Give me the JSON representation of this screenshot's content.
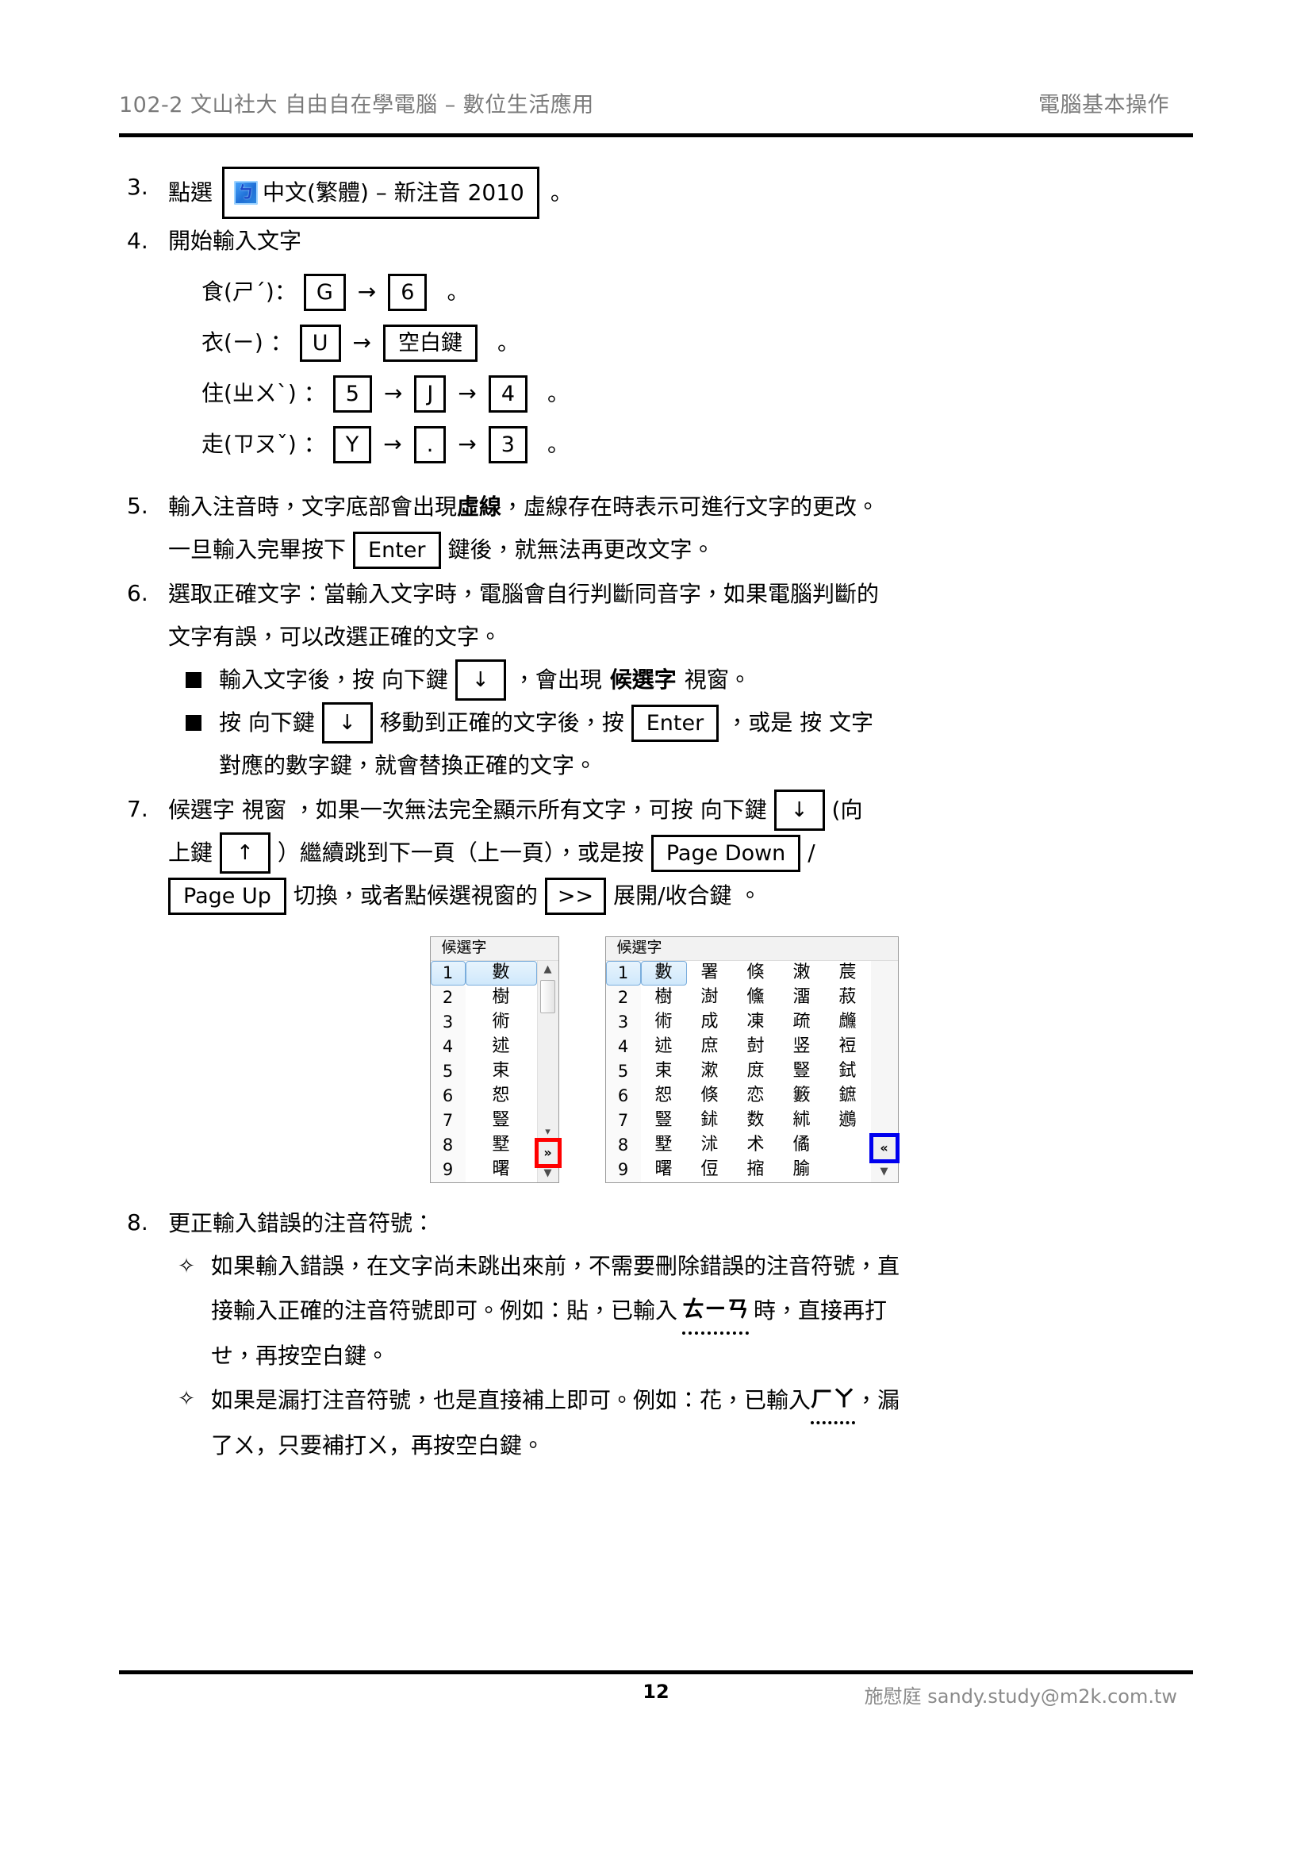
{
  "header": {
    "left": "102-2 文山社大 自由自在學電腦 – 數位生活應用",
    "right": "電腦基本操作"
  },
  "items": {
    "i3": {
      "num": "3.",
      "lead": "點選",
      "ime_icon_glyph": "ㄅ",
      "ime_label": "中文(繁體) – 新注音 2010",
      "tail": "。"
    },
    "i4": {
      "num": "4.",
      "text": "開始輸入文字",
      "examples": [
        {
          "label": "食(ㄕˊ)：",
          "keys": [
            "G",
            "6"
          ],
          "tail": "。"
        },
        {
          "label": "衣(ㄧ) ：",
          "keys": [
            "U",
            "空白鍵"
          ],
          "tail": "。"
        },
        {
          "label": "住(ㄓㄨˋ) ：",
          "keys": [
            "5",
            "J",
            "4"
          ],
          "tail": "。"
        },
        {
          "label": "走(ㄗㄡˇ) ：",
          "keys": [
            "Y",
            ".",
            "3"
          ],
          "tail": "。"
        }
      ]
    },
    "i5": {
      "num": "5.",
      "line1_a": "輸入注音時，文字底部會出現",
      "line1_bold": "虛線",
      "line1_b": "，虛線存在時表示可進行文字的更改。",
      "line2_a": "一旦輸入完畢按下",
      "line2_key": "Enter",
      "line2_b": "鍵後，就無法再更改文字。"
    },
    "i6": {
      "num": "6.",
      "line1": "選取正確文字：當輸入文字時，電腦會自行判斷同音字，如果電腦判斷的",
      "line2": "文字有誤，可以改選正確的文字。",
      "bullets": [
        {
          "a": "輸入文字後，按 向下鍵",
          "key": "↓",
          "b": "，會出現",
          "bold": "候選字",
          "c": "視窗。"
        },
        {
          "a": "按 向下鍵",
          "key": "↓",
          "b": "移動到正確的文字後，按",
          "key2": "Enter",
          "c": "，或是 按 文字",
          "d": "對應的數字鍵，就會替換正確的文字。"
        }
      ]
    },
    "i7": {
      "num": "7.",
      "line1_a": "候選字 視窗 ，如果一次無法完全顯示所有文字，可按 向下鍵",
      "line1_key": "↓",
      "line1_b": "(向",
      "line2_a": "上鍵",
      "line2_key": "↑",
      "line2_b": "）繼續跳到下一頁（上一頁），或是按",
      "line2_key2": "Page Down",
      "line2_c": "/",
      "line3_key": "Page Up",
      "line3_a": "切換，或者點候選視窗的",
      "line3_key2": ">>",
      "line3_b": "展開/收合鍵 。"
    },
    "i8": {
      "num": "8.",
      "title": "更正輸入錯誤的注音符號：",
      "bullets": [
        {
          "marker": "✧",
          "line1": "如果輸入錯誤，在文字尚未跳出來前，不需要刪除錯誤的注音符號，直",
          "line2_a": "接輸入正確的注音符號即可。例如：貼，已輸入",
          "line2_bopomofo": "ㄊㄧㄢ",
          "line2_b": "時，直接再打",
          "line3": "せ，再按空白鍵。"
        },
        {
          "marker": "✧",
          "line1_a": "如果是漏打注音符號，也是直接補上即可。例如：花，已輸入",
          "line1_bopomofo": "ㄏㄚ",
          "line1_b": "，漏",
          "line2": "了ㄨ，只要補打ㄨ，再按空白鍵。"
        }
      ]
    }
  },
  "candidate_windows": {
    "left": {
      "title": "候選字",
      "numbers": [
        "1",
        "2",
        "3",
        "4",
        "5",
        "6",
        "7",
        "8",
        "9"
      ],
      "column1": [
        "數",
        "樹",
        "術",
        "述",
        "束",
        "恕",
        "豎",
        "墅",
        "曙"
      ],
      "selected_index": 0,
      "expand_button": "»",
      "expand_button_highlight": "#ff0000",
      "scroll_up": "▲",
      "scroll_down": "▼"
    },
    "right": {
      "title": "候選字",
      "numbers": [
        "1",
        "2",
        "3",
        "4",
        "5",
        "6",
        "7",
        "8",
        "9"
      ],
      "column1": [
        "數",
        "樹",
        "術",
        "述",
        "束",
        "恕",
        "豎",
        "墅",
        "曙"
      ],
      "column2": [
        "署",
        "澍",
        "成",
        "庶",
        "漱",
        "倏",
        "鉥",
        "沭",
        "侸"
      ],
      "column3": [
        "倏",
        "儵",
        "凍",
        "尌",
        "庻",
        "恋",
        "数",
        "术",
        "摍"
      ],
      "column4": [
        "潄",
        "澑",
        "疏",
        "竖",
        "豎",
        "籔",
        "絉",
        "僪",
        "腧"
      ],
      "column5": [
        "莀",
        "菽",
        "虪",
        "裋",
        "鉽",
        "鏣",
        "鶐"
      ],
      "selected_index": 0,
      "collapse_button": "«",
      "collapse_button_highlight": "#0000ee",
      "scroll_down": "▼"
    }
  },
  "footer": {
    "page_number": "12",
    "author_contact": "施慰庭 sandy.study@m2k.com.tw"
  }
}
